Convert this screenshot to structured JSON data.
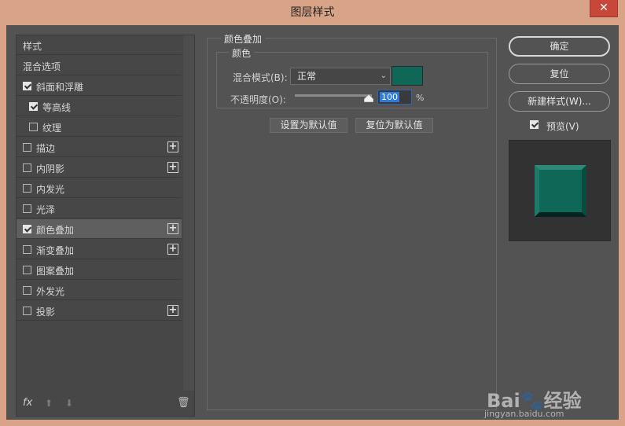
{
  "window": {
    "title": "图层样式",
    "close_glyph": "✕"
  },
  "style_list": {
    "items": [
      {
        "label": "样式",
        "checkbox": false,
        "checked": false,
        "plus": false,
        "active": false
      },
      {
        "label": "混合选项",
        "checkbox": false,
        "checked": false,
        "plus": false,
        "active": false
      },
      {
        "label": "斜面和浮雕",
        "checkbox": true,
        "checked": true,
        "plus": false,
        "active": false
      },
      {
        "label": "等高线",
        "checkbox": true,
        "checked": true,
        "plus": false,
        "active": false,
        "indent": true
      },
      {
        "label": "纹理",
        "checkbox": true,
        "checked": false,
        "plus": false,
        "active": false,
        "indent": true
      },
      {
        "label": "描边",
        "checkbox": true,
        "checked": false,
        "plus": true,
        "active": false
      },
      {
        "label": "内阴影",
        "checkbox": true,
        "checked": false,
        "plus": true,
        "active": false
      },
      {
        "label": "内发光",
        "checkbox": true,
        "checked": false,
        "plus": false,
        "active": false
      },
      {
        "label": "光泽",
        "checkbox": true,
        "checked": false,
        "plus": false,
        "active": false
      },
      {
        "label": "颜色叠加",
        "checkbox": true,
        "checked": true,
        "plus": true,
        "active": true
      },
      {
        "label": "渐变叠加",
        "checkbox": true,
        "checked": false,
        "plus": true,
        "active": false
      },
      {
        "label": "图案叠加",
        "checkbox": true,
        "checked": false,
        "plus": false,
        "active": false
      },
      {
        "label": "外发光",
        "checkbox": true,
        "checked": false,
        "plus": false,
        "active": false
      },
      {
        "label": "投影",
        "checkbox": true,
        "checked": false,
        "plus": true,
        "active": false
      }
    ],
    "plus_glyph": "+",
    "fx_label": "fx",
    "up_glyph": "⬆",
    "down_glyph": "⬇",
    "trash_glyph": "🗑"
  },
  "color_overlay": {
    "group_title": "颜色叠加",
    "sub_title": "颜色",
    "blend_mode_label": "混合模式(B):",
    "blend_mode_value": "正常",
    "chevron_glyph": "⌄",
    "opacity_label": "不透明度(O):",
    "opacity_value": "100",
    "opacity_unit": "%",
    "opacity_fraction": 1.0,
    "overlay_color": "#0f6757",
    "set_default_label": "设置为默认值",
    "reset_default_label": "复位为默认值"
  },
  "actions": {
    "ok_label": "确定",
    "reset_label": "复位",
    "new_style_label": "新建样式(W)...",
    "preview_label": "预览(V)",
    "preview_checked": true
  },
  "watermark": {
    "logo": "Bai🐾经验",
    "url": "jingyan.baidu.com"
  }
}
